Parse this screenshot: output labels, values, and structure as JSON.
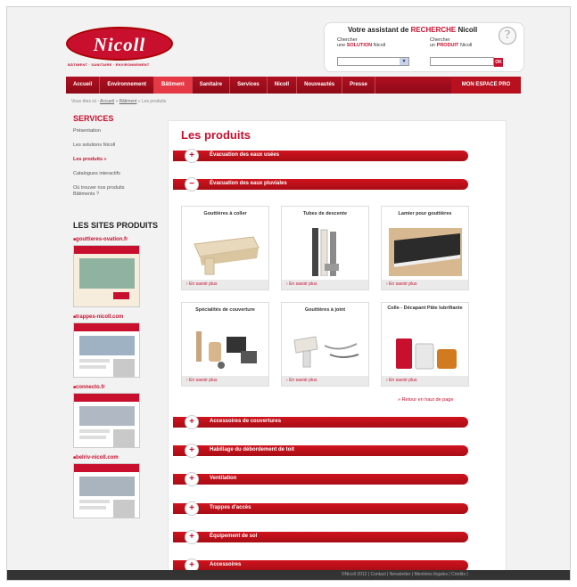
{
  "brand": {
    "logo": "Nicoll",
    "tagline": "BÂTIMENT · SANITAIRE · ENVIRONNEMENT"
  },
  "assistant": {
    "title_prefix": "Votre assistant de",
    "title_highlight": "RECHERCHE",
    "title_suffix": "Nicoll",
    "help_glyph": "?",
    "col1_line1": "Chercher",
    "col1_line2_prefix": "une",
    "col1_line2_highlight": "SOLUTION",
    "col1_line2_suffix": "Nicoll",
    "col2_line1": "Chercher",
    "col2_line2_prefix": "un",
    "col2_line2_highlight": "PRODUIT",
    "col2_line2_suffix": "Nicoll",
    "dropdown_arrow": "▼",
    "ok": "OK"
  },
  "nav": {
    "items": [
      "Accueil",
      "Environnement",
      "Bâtiment",
      "Sanitaire",
      "Services",
      "Nicoll",
      "Nouveautés",
      "Presse"
    ],
    "active": "Bâtiment",
    "pro": "MON ESPACE PRO"
  },
  "breadcrumb": {
    "prefix": "Vous êtes ici :",
    "home": "Accueil",
    "section": "Bâtiment",
    "current": "Les produits"
  },
  "sidebar": {
    "services_title": "SERVICES",
    "items": [
      "Présentation",
      "Les solutions Nicoll",
      "Les produits  »",
      "Catalogues interactifs",
      "Où trouver nos produits Bâtiments ?"
    ],
    "sites_title": "LES SITES PRODUITS",
    "sites": [
      "gouttieres-ovation.fr",
      "trappes-nicoll.com",
      "connecto.fr",
      "belriv-nicoll.com"
    ]
  },
  "main": {
    "title": "Les produits",
    "sections_top": [
      {
        "sign": "+",
        "label": "Évacuation des eaux usées"
      },
      {
        "sign": "−",
        "label": "Évacuation des eaux pluviales"
      }
    ],
    "products": [
      {
        "name": "Gouttières à coller"
      },
      {
        "name": "Tubes de descente"
      },
      {
        "name": "Lamier pour gouttières"
      },
      {
        "name": "Spécialités de couverture"
      },
      {
        "name": "Gouttières à joint"
      },
      {
        "name": "Colle - Décapant Pâte lubrifiante"
      }
    ],
    "more_link": "En savoir plus",
    "back_to_top": "»  Retour en haut de page",
    "sections_bottom": [
      "Accessoires de couvertures",
      "Habillage du débordement de toit",
      "Ventilation",
      "Trappes d'accès",
      "Équipement de sol",
      "Accessoires"
    ],
    "plus": "+"
  },
  "footer": {
    "text": "©Nicoll 2012  |  Contact  |  Newsletter  |  Mentions légales  |  Crédits  |"
  },
  "colors": {
    "brand_red": "#c8102e"
  }
}
